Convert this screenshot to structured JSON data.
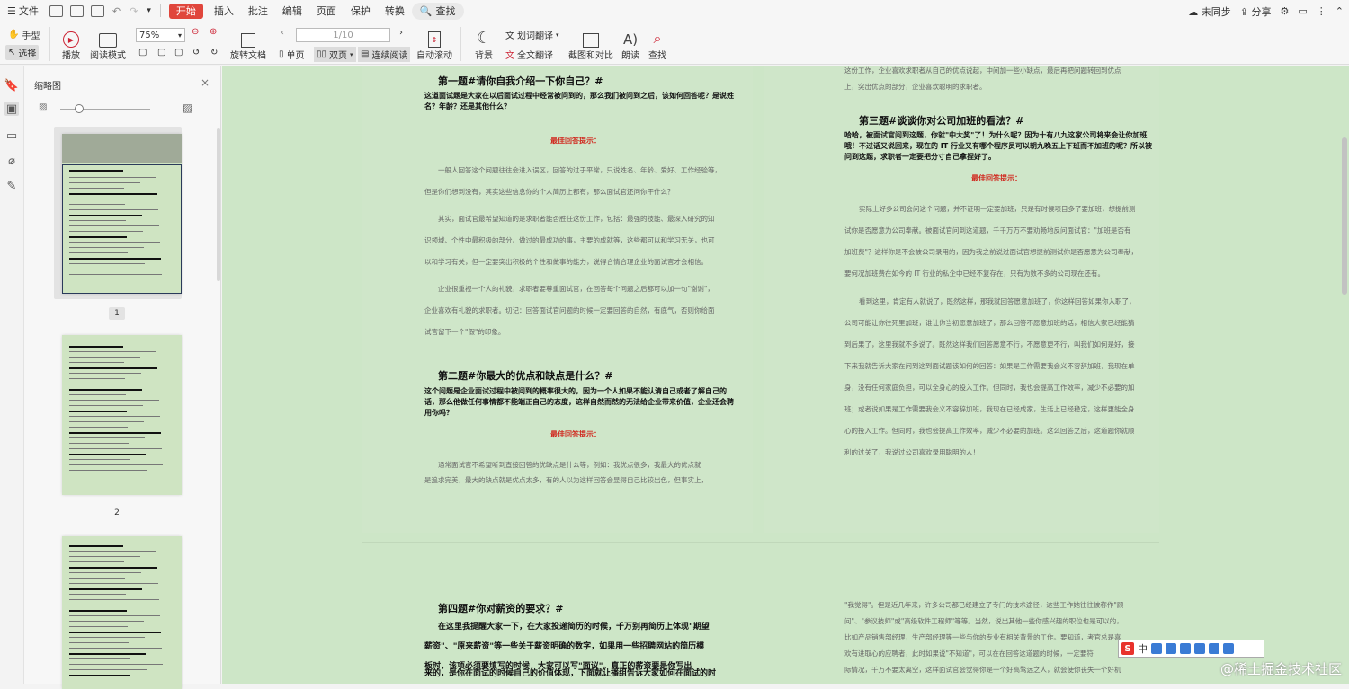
{
  "menu": {
    "file": "文件",
    "tabs": [
      "开始",
      "插入",
      "批注",
      "编辑",
      "页面",
      "保护",
      "转换"
    ],
    "search": "查找",
    "right": {
      "sync": "未同步",
      "share": "分享"
    }
  },
  "toolbar": {
    "hand": "手型",
    "select": "选择",
    "play": "播放",
    "read_mode": "阅读模式",
    "zoom": "75%",
    "page": "1/10",
    "rotate": "旋转文档",
    "single": "单页",
    "double": "双页",
    "continuous": "连续阅读",
    "auto_scroll": "自动滚动",
    "background": "背景",
    "word_translate": "划词翻译",
    "full_translate": "全文翻译",
    "screenshot": "截图和对比",
    "read_aloud": "朗读",
    "find": "查找"
  },
  "panel": {
    "title": "缩略图",
    "pages": [
      "1",
      "2"
    ]
  },
  "doc": {
    "q1_title": "第一题#请你自我介绍一下你自己？#",
    "q1_bold": "这道面试题是大家在以后面试过程中经常被问到的，那么我们被问到之后，该如何回答呢？是说姓名？年龄？还是其他什么？",
    "tip": "最佳回答提示：",
    "q1_p1": "一般人回答这个问题往往会进入误区，回答的过于平常，只说姓名、年龄、爱好、工作经验等，",
    "q1_p2": "但是你们想到没有，其实这些信息你的个人简历上都有，那么面试官还问你干什么？",
    "q1_p3": "其实，面试官最希望知道的是求职者能否胜任这份工作，包括：最强的技能、最深入研究的知",
    "q1_p4": "识领域、个性中最积极的部分、做过的最成功的事，主要的成就等，这些都可以和学习无关，也可",
    "q1_p5": "以和学习有关，但一定要突出积极的个性和做事的能力，说得合情合理企业的面试官才会相信。",
    "q1_p6": "企业很重视一个人的礼貌，求职者要尊重面试官，在回答每个问题之后都可以加一句\"谢谢\"，",
    "q1_p7": "企业喜欢有礼貌的求职者。切记：回答面试官问题的时候一定要回答的自然，有底气，否则你给面",
    "q1_p8": "试官留下一个\"假\"的印象。",
    "q2_title": "第二题#你最大的优点和缺点是什么？#",
    "q2_bold": "这个问题是企业面试过程中被问到的概率很大的，因为一个人如果不能认清自己或者了解自己的话，那么他做任何事情都不能端正自己的态度，这样自然而然的无法给企业带来价值，企业还会聘用你吗？",
    "q2_p1": "通常面试官不希望听到直接回答的优缺点是什么等，例如：我优点很多，我最大的优点就",
    "q2_p2": "是追求完美，最大的缺点就是优点太多，有的人以为这样回答会显得自己比较出色，但事实上，",
    "q3_top1": "这份工作，企业喜欢求职者从自己的优点说起，中间加一些小缺点，最后再把问题转回到优点",
    "q3_top2": "上，突出优点的部分，企业喜欢聪明的求职者。",
    "q3_title": "第三题#谈谈你对公司加班的看法？#",
    "q3_bold": "哈哈，被面试官问到这题，你就\"中大奖\"了！为什么呢？因为十有八九这家公司将来会让你加班哦！不过话又说回来，现在的 IT 行业又有哪个程序员可以朝九晚五上下班而不加班的呢？所以被问到这题，求职者一定要把分寸自己拿捏好了。",
    "q3_p1": "实际上好多公司会问这个问题，并不证明一定要加班，只是有时候项目多了要加班，想提前测",
    "q3_p2": "试你是否愿意为公司奉献。被面试官问到这道题，千千万万不要劝畅地反问面试官：\"加班是否有",
    "q3_p3": "加班费\"？这样你是不会被公司录用的，因为我之前说过面试官想提前测试你是否愿意为公司奉献，",
    "q3_p4": "要何况加班费在如今的 IT 行业的私企中已经不复存在，只有为数不多的公司现在还有。",
    "q3_p5": "看到这里，肯定有人就说了，既然这样，那我就回答愿意加班了，你这样回答如果你入职了，",
    "q3_p6": "公司可能让你往死里加班，谁让你当初愿意加班了，那么回答不愿意加班的话，相信大家已经能猜",
    "q3_p7": "到后果了，这里我就不多说了。既然这样我们回答愿意不行，不愿意更不行，叫我们如何是好，接",
    "q3_p8": "下来我就告诉大家在问到这到面试题该如何的回答：如果是工作需要我会义不容辞加班，我现在单",
    "q3_p9": "身，没有任何家庭负担，可以全身心的投入工作。但同时，我也会提高工作效率，减少不必要的加",
    "q3_p10": "班；或者说如果是工作需要我会义不容辞加班，我现在已经成家，生活上已经稳定，这样更能全身",
    "q3_p11": "心的投入工作。但同时，我也会提高工作效率，减少不必要的加班。这么回答之后，这道题你就顺",
    "q3_p12": "利的过关了，我说过公司喜欢录用聪明的人！",
    "q4_title": "第四题#你对薪资的要求？#",
    "q4_b1": "在这里我提醒大家一下，在大家投递简历的时候，千万别再简历上体现\"期望",
    "q4_b2": "薪资\"、\"原来薪资\"等一些关于薪资明确的数字，如果用一些招聘网站的简历模",
    "q4_b3": "板时，该项必须要填写的时候，大家可以写\"面议\"。真正的薪资要是你写出",
    "q4_b4": "来的，是你在面试的时候自己的价值体现，下面就让播组告诉大家如何在面试的时",
    "r4_p1": "\"我觉得\"。但是近几年来，许多公司都已经建立了专门的技术途径，这些工作她往往被称作\"顾",
    "r4_p2": "问\"、\"参议技师\"或\"高级软件工程师\"等等。当然，说出其他一些你感兴趣的职位也是可以的，",
    "r4_p3": "比如产品销售部经理，生产部经理等一些与你的专业有相关背景的工作。要知道，考官总是喜",
    "r4_p4": "欢有进取心的应聘者，此时如果说\"不知道\"，可以在在回答这道题的时候，一定要符",
    "r4_p5": "际情况，千万不要太离空，这样面试官会觉得你是一个好高骛远之人，就会使你丧失一个好机"
  },
  "ime": {
    "label": "中"
  },
  "watermark": "@稀土掘金技术社区"
}
